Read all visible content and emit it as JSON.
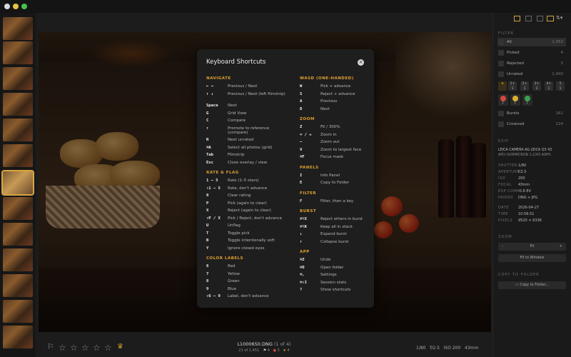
{
  "toolbar": {
    "layout_icon": "sort-icon"
  },
  "modal": {
    "title": "Keyboard Shortcuts",
    "left_groups": [
      {
        "title": "NAVIGATE",
        "rows": [
          {
            "key": "← →",
            "desc": "Previous / Next"
          },
          {
            "key": "↑ ↓",
            "desc": "Previous / Next (left filmstrip)"
          },
          {
            "key": "Space",
            "desc": "Next"
          },
          {
            "key": "G",
            "desc": "Grid View"
          },
          {
            "key": "C",
            "desc": "Compare"
          },
          {
            "key": "↑",
            "desc": "Promote to reference (compare)"
          },
          {
            "key": "N",
            "desc": "Next unrated"
          },
          {
            "key": "⌘A",
            "desc": "Select all photos (grid)"
          },
          {
            "key": "Tab",
            "desc": "Filmstrip"
          },
          {
            "key": "Esc",
            "desc": "Close overlay / view"
          }
        ]
      },
      {
        "title": "RATE & FLAG",
        "rows": [
          {
            "key": "1 – 5",
            "desc": "Rate (1–5 stars)"
          },
          {
            "key": "⇧1 – 5",
            "desc": "Rate, don't advance"
          },
          {
            "key": "0",
            "desc": "Clear rating"
          },
          {
            "key": "P",
            "desc": "Pick (again to clear)"
          },
          {
            "key": "X",
            "desc": "Reject (again to clear)"
          },
          {
            "key": "⇧P / X",
            "desc": "Pick / Reject, don't advance"
          },
          {
            "key": "U",
            "desc": "Unflag"
          },
          {
            "key": "T",
            "desc": "Toggle pick"
          },
          {
            "key": "B",
            "desc": "Toggle intentionally soft"
          },
          {
            "key": "Y",
            "desc": "Ignore closed eyes"
          }
        ]
      },
      {
        "title": "COLOR LABELS",
        "rows": [
          {
            "key": "6",
            "desc": "Red"
          },
          {
            "key": "7",
            "desc": "Yellow"
          },
          {
            "key": "8",
            "desc": "Green"
          },
          {
            "key": "9",
            "desc": "Blue"
          },
          {
            "key": "⇧6 – 9",
            "desc": "Label, don't advance"
          }
        ]
      }
    ],
    "right_groups": [
      {
        "title": "WASD (ONE-HANDED)",
        "rows": [
          {
            "key": "W",
            "desc": "Pick + advance"
          },
          {
            "key": "S",
            "desc": "Reject + advance"
          },
          {
            "key": "A",
            "desc": "Previous"
          },
          {
            "key": "D",
            "desc": "Next"
          }
        ]
      },
      {
        "title": "ZOOM",
        "rows": [
          {
            "key": "Z",
            "desc": "Fit / 300%"
          },
          {
            "key": "= / +",
            "desc": "Zoom in"
          },
          {
            "key": "–",
            "desc": "Zoom out"
          },
          {
            "key": "V",
            "desc": "Zoom to largest face"
          },
          {
            "key": "⌘F",
            "desc": "Focus mask"
          }
        ]
      },
      {
        "title": "PANELS",
        "rows": [
          {
            "key": "I",
            "desc": "Info Panel"
          },
          {
            "key": "E",
            "desc": "Copy to Folder"
          }
        ]
      },
      {
        "title": "FILTER",
        "rows": [
          {
            "key": "F",
            "desc": "Filter, then a key"
          }
        ]
      },
      {
        "title": "BURST",
        "rows": [
          {
            "key": "⌘⌥X",
            "desc": "Reject others in burst"
          },
          {
            "key": "⌘⌥K",
            "desc": "Keep all in stack"
          },
          {
            "key": "↓",
            "desc": "Expand burst"
          },
          {
            "key": "↑",
            "desc": "Collapse burst"
          }
        ]
      },
      {
        "title": "APP",
        "rows": [
          {
            "key": "⌘Z",
            "desc": "Undo"
          },
          {
            "key": "⌘O",
            "desc": "Open folder"
          },
          {
            "key": "⌘,",
            "desc": "Settings"
          },
          {
            "key": "⌘⇧I",
            "desc": "Session stats"
          },
          {
            "key": "?",
            "desc": "Show shortcuts"
          }
        ]
      }
    ]
  },
  "filter": {
    "title": "FILTER",
    "rows": [
      {
        "label": "All",
        "count": "1,452"
      },
      {
        "label": "Picked",
        "count": "4"
      },
      {
        "label": "Rejected",
        "count": "3"
      },
      {
        "label": "Unrated",
        "count": "1,400"
      }
    ],
    "ratings": [
      {
        "label": "1+",
        "count": "1"
      },
      {
        "label": "2+",
        "count": "1"
      },
      {
        "label": "3+",
        "count": "1"
      },
      {
        "label": "4+",
        "count": "1"
      },
      {
        "label": "5",
        "count": "1"
      }
    ],
    "colors": [
      {
        "hex": "#d04a3a",
        "count": "1"
      },
      {
        "hex": "#d8b030",
        "count": "1"
      },
      {
        "hex": "#3aa050",
        "count": "1"
      }
    ],
    "extra": [
      {
        "label": "Bursts",
        "count": "161"
      },
      {
        "label": "Crowned",
        "count": "224"
      }
    ]
  },
  "exif": {
    "title": "EXIF",
    "camera": "LEICA CAMERA AG LEICA Q3 43",
    "lens": "APO-SUMMICRON 1:2/43 ASPH.",
    "fields": [
      {
        "k": "SHUTTER",
        "v": "1/80"
      },
      {
        "k": "APERTURE",
        "v": "f/2.5"
      },
      {
        "k": "ISO",
        "v": "200"
      },
      {
        "k": "FOCAL",
        "v": "43mm"
      },
      {
        "k": "EXP COMP",
        "v": "-0.6 EV"
      },
      {
        "k": "PAIRED",
        "v": "DNG + JPG"
      },
      {
        "k": "DATE",
        "v": "2026-04-27"
      },
      {
        "k": "TIME",
        "v": "10:56:51"
      },
      {
        "k": "PIXELS",
        "v": "9520 × 6336"
      }
    ]
  },
  "zoom": {
    "title": "ZOOM",
    "minus": "–",
    "value": "Fit",
    "plus": "+",
    "fit_label": "Fit to Window"
  },
  "copy": {
    "title": "COPY TO FOLDER",
    "button": "Copy to Folder..."
  },
  "bottom": {
    "filename": "L1000650.DNG",
    "position": "(1 of 4)",
    "count": "21 of 1,451",
    "flags": "4",
    "rejects": "3",
    "stars": "4",
    "shutter": "1/80",
    "aperture": "f/2.5",
    "iso": "ISO 200",
    "focal": "43mm",
    "star_glyph": "☆",
    "flag_glyph": "⚐",
    "crown_glyph": "♛"
  }
}
